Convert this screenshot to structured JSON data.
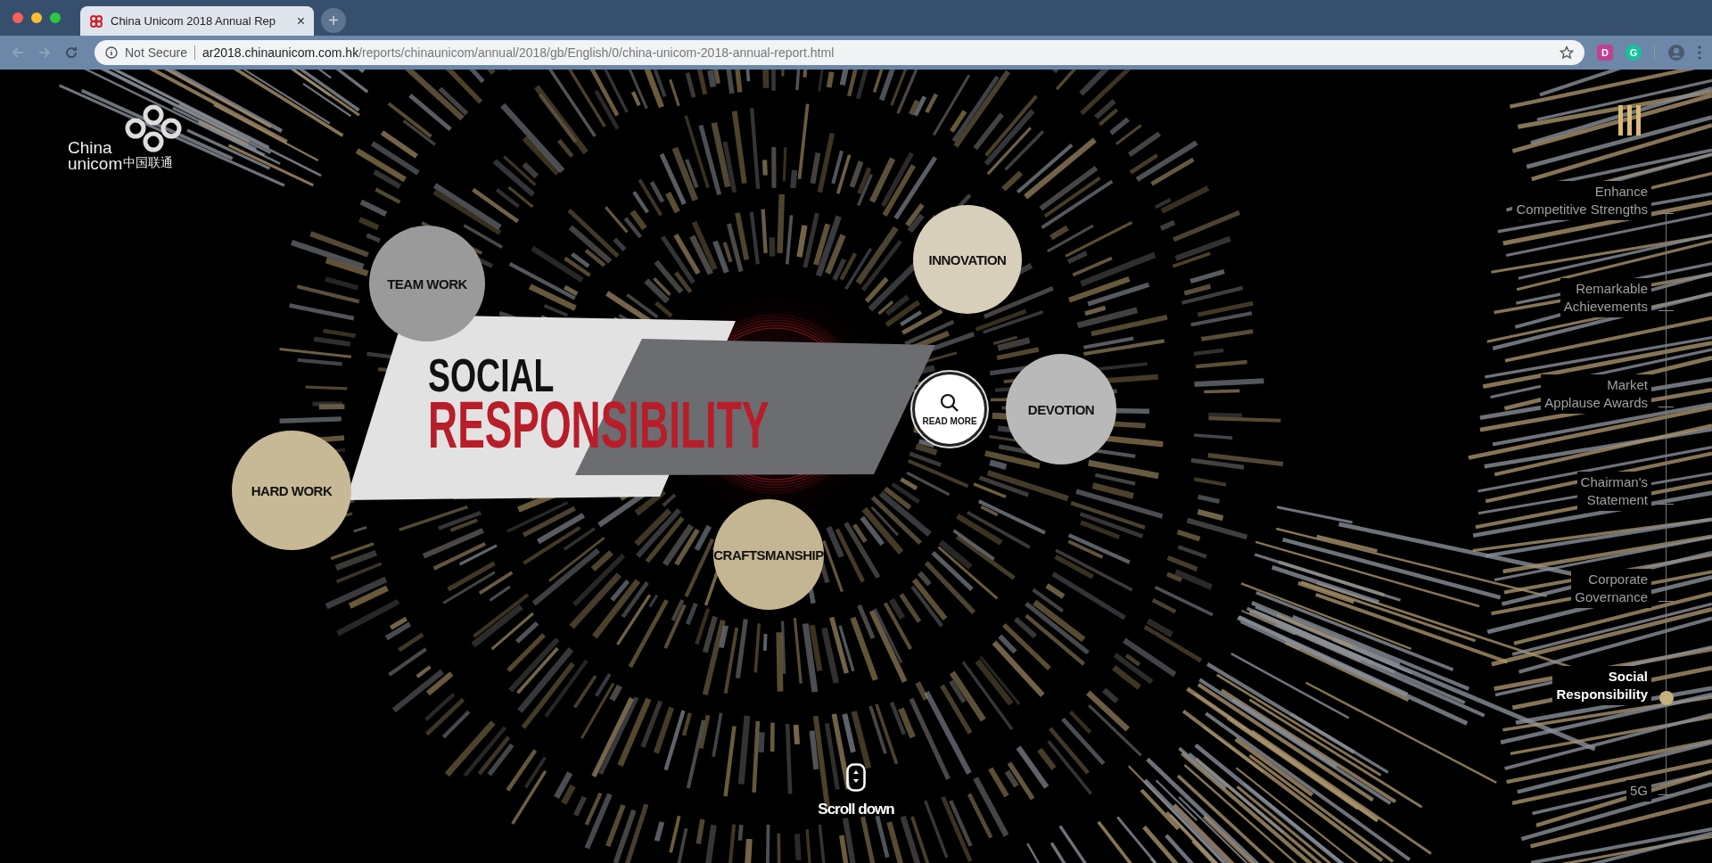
{
  "browser": {
    "tab": {
      "title": "China Unicom 2018 Annual Rep",
      "close": "×",
      "selected": true
    },
    "new_tab": "+",
    "address": {
      "security": "Not Secure",
      "host": "ar2018.chinaunicom.com.hk",
      "path": "/reports/chinaunicom/annual/2018/gb/English/0/china-unicom-2018-annual-report.html"
    },
    "extensions": [
      {
        "letter": "D",
        "color": "#c1408f"
      },
      {
        "letter": "G",
        "color": "#15c39a"
      }
    ]
  },
  "logo": {
    "line_1": "China",
    "line_2": "unicom",
    "chinese": "中国联通"
  },
  "hero": {
    "title_1": "SOCIAL",
    "title_2": "RESPONSIBILITY",
    "read_more": "READ MORE",
    "values": [
      {
        "label": "TEAM WORK"
      },
      {
        "label": "INNOVATION"
      },
      {
        "label": "DEVOTION"
      },
      {
        "label": "CRAFTSMANSHIP"
      },
      {
        "label": "HARD WORK"
      }
    ]
  },
  "timeline": [
    {
      "lines": [
        "Enhance",
        "Competitive Strengths"
      ],
      "selected": false
    },
    {
      "lines": [
        "Remarkable",
        "Achievements"
      ],
      "selected": false
    },
    {
      "lines": [
        "Market",
        "Applause Awards"
      ],
      "selected": false
    },
    {
      "lines": [
        "Chairman's",
        "Statement"
      ],
      "selected": false
    },
    {
      "lines": [
        "Corporate",
        "Governance"
      ],
      "selected": false
    },
    {
      "lines": [
        "Social",
        "Responsibility"
      ],
      "selected": true
    },
    {
      "lines": [
        "5G"
      ],
      "selected": false
    }
  ],
  "scroll_hint": "Scroll down"
}
